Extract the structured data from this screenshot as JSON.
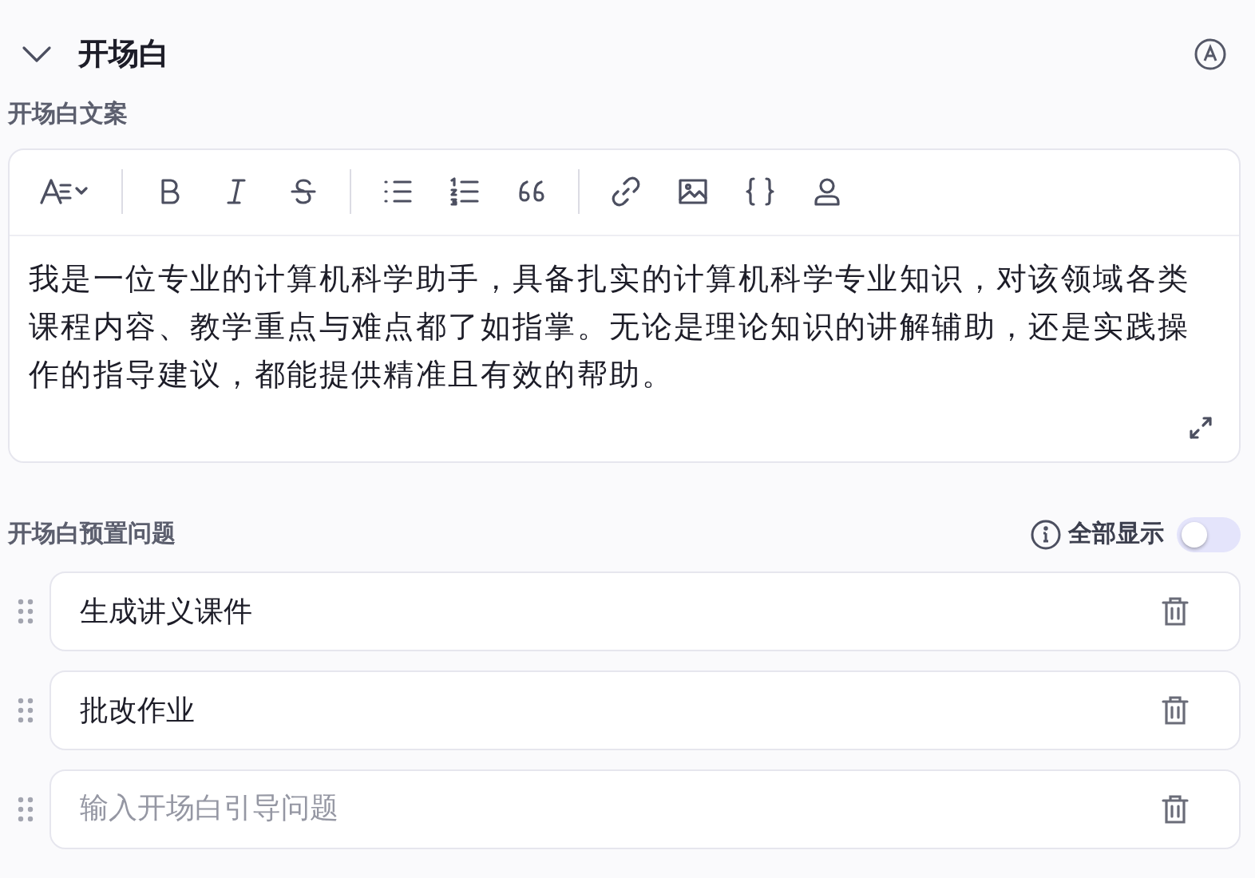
{
  "section": {
    "title": "开场白",
    "expanded": true
  },
  "editor": {
    "label": "开场白文案",
    "toolbar": [
      {
        "kind": "heading"
      },
      {
        "kind": "sep"
      },
      {
        "kind": "bold"
      },
      {
        "kind": "italic"
      },
      {
        "kind": "strike"
      },
      {
        "kind": "sep"
      },
      {
        "kind": "bullets"
      },
      {
        "kind": "numbers"
      },
      {
        "kind": "quote"
      },
      {
        "kind": "sep"
      },
      {
        "kind": "link"
      },
      {
        "kind": "image"
      },
      {
        "kind": "braces"
      },
      {
        "kind": "user"
      }
    ],
    "content": "我是一位专业的计算机科学助手，具备扎实的计算机科学专业知识，对该领域各类课程内容、教学重点与难点都了如指掌。无论是理论知识的讲解辅助，还是实践操作的指导建议，都能提供精准且有效的帮助。"
  },
  "presets": {
    "label": "开场白预置问题",
    "show_all": {
      "label": "全部显示",
      "on": false
    },
    "questions": [
      {
        "value": "生成讲义课件"
      },
      {
        "value": "批改作业"
      },
      {
        "placeholder": "输入开场白引导问题"
      }
    ]
  }
}
